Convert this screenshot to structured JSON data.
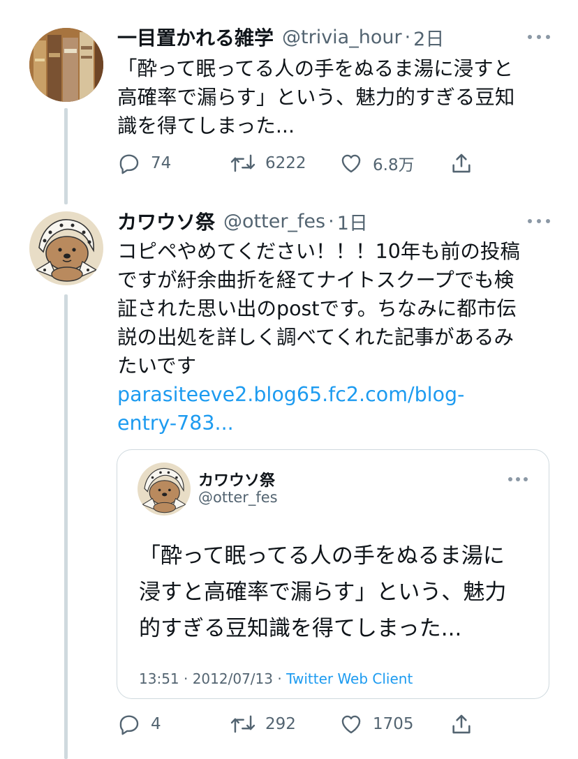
{
  "tweet1": {
    "name": "一目置かれる雑学",
    "handle": "@trivia_hour",
    "separator": "·",
    "time": "2日",
    "text_lines": [
      "「酔って眠ってる人の手をぬるま湯に浸すと",
      "高確率で漏らす」という、魅力的すぎる豆知",
      "識を得てしまった..."
    ],
    "replies": "74",
    "retweets": "6222",
    "likes": "6.8万"
  },
  "tweet2": {
    "name": "カワウソ祭",
    "handle": "@otter_fes",
    "separator": "·",
    "time": "1日",
    "text_lines": [
      "コピペやめてください！！！10年も前の投稿",
      "ですが紆余曲折を経てナイトスクープでも検",
      "証された思い出のpostです。ちなみに都市伝",
      "説の出処を詳しく調べてくれた記事があるみ",
      "たいです"
    ],
    "link_lines": [
      "parasiteeve2.blog65.fc2.com/blog-",
      "entry-783..."
    ],
    "replies": "4",
    "retweets": "292",
    "likes": "1705"
  },
  "quoted": {
    "name": "カワウソ祭",
    "handle": "@otter_fes",
    "text_lines": [
      "「酔って眠ってる人の手をぬるま湯に",
      "浸すと高確率で漏らす」という、魅力",
      "的すぎる豆知識を得てしまった..."
    ],
    "time": "13:51 · 2012/07/13 · ",
    "client": "Twitter Web Client"
  },
  "icons": {
    "reply": "speech-bubble-icon",
    "retweet": "retweet-arrows-icon",
    "like": "heart-outline-icon",
    "share": "share-upload-icon",
    "more": "more-dots-icon"
  },
  "colors": {
    "link": "#1d9bf0",
    "secondary": "#536471",
    "thread_line": "#cfd9de"
  }
}
